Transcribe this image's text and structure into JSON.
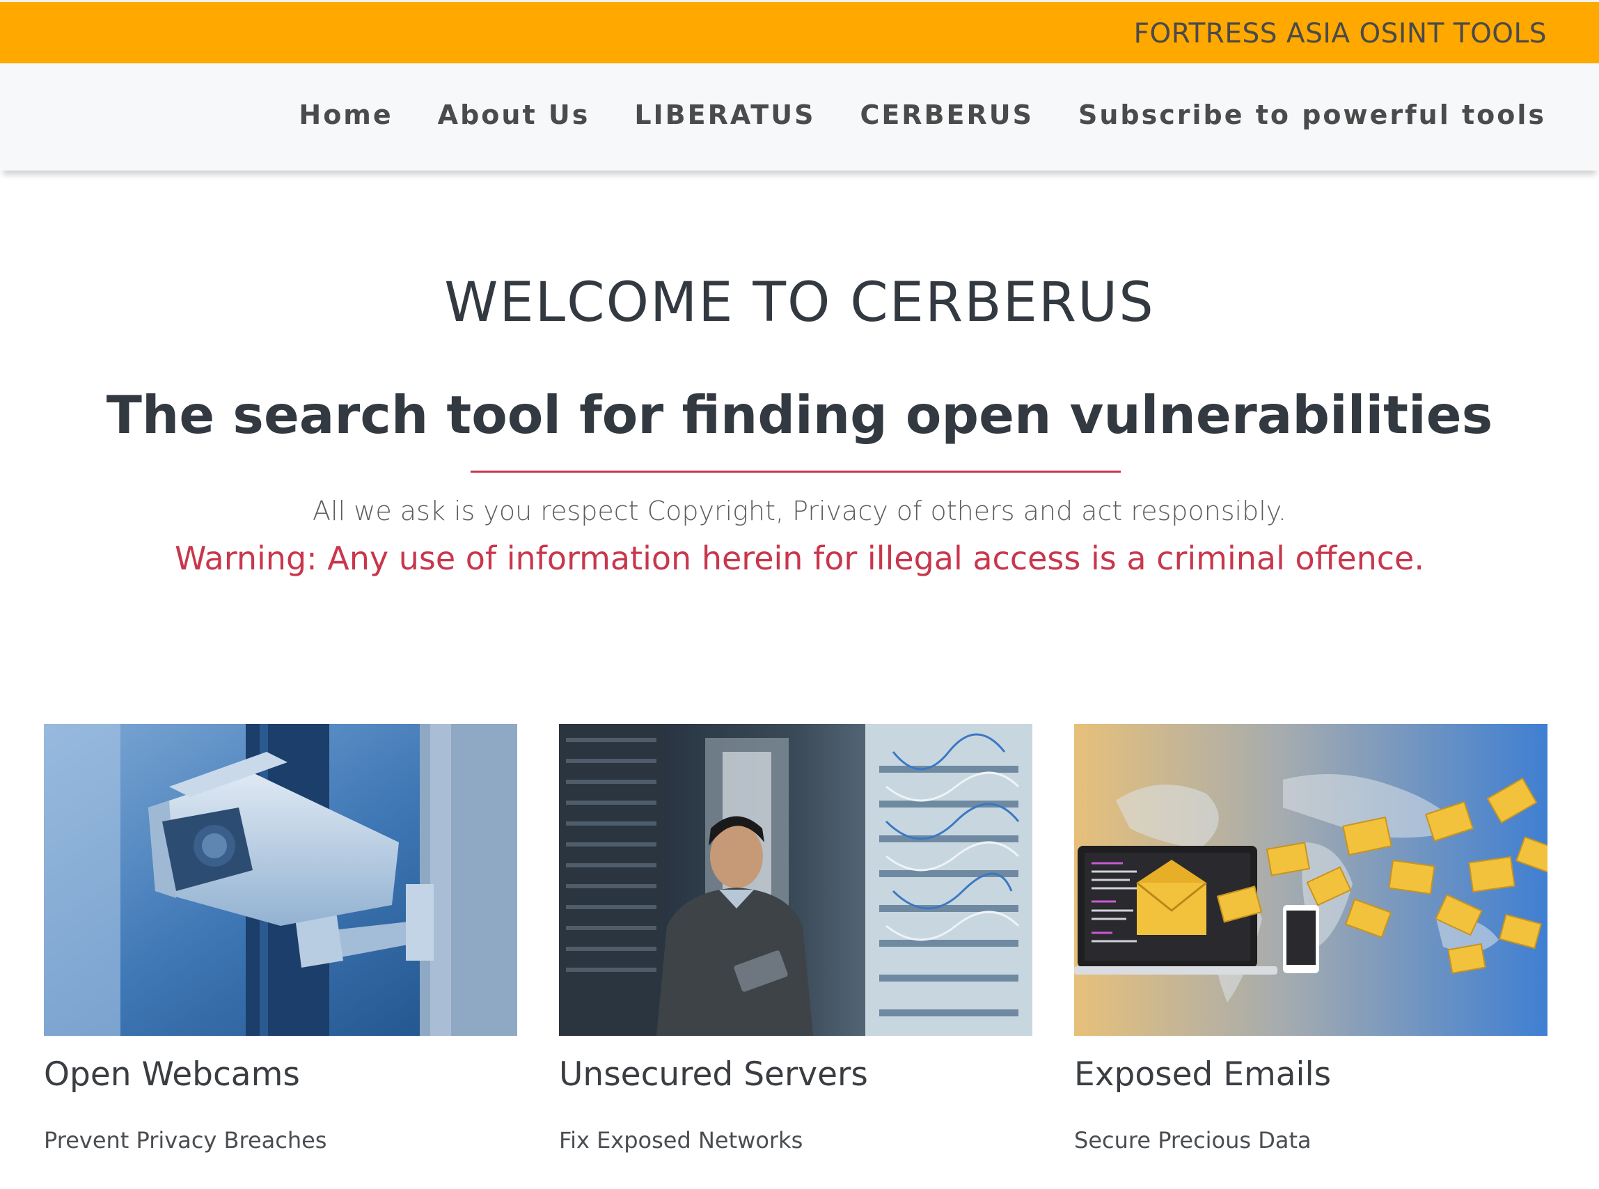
{
  "header": {
    "brand": "FORTRESS ASIA OSINT TOOLS",
    "accent_color": "#ffa800"
  },
  "nav": {
    "items": [
      {
        "label": "Home"
      },
      {
        "label": "About Us"
      },
      {
        "label": "LIBERATUS"
      },
      {
        "label": "CERBERUS"
      },
      {
        "label": "Subscribe to powerful tools"
      }
    ]
  },
  "hero": {
    "title": "WELCOME TO CERBERUS",
    "tagline": "The search tool for finding open vulnerabilities",
    "notice": "All we ask is you respect Copyright, Privacy of others and act responsibly.",
    "warning": "Warning: Any use of information herein for illegal access is a criminal offence.",
    "warning_color": "#c8374c"
  },
  "cards": [
    {
      "title": "Open Webcams",
      "subtitle": "Prevent Privacy Breaches",
      "image": "security-camera-photo"
    },
    {
      "title": "Unsecured Servers",
      "subtitle": "Fix Exposed Networks",
      "image": "server-room-photo"
    },
    {
      "title": "Exposed Emails",
      "subtitle": "Secure Precious Data",
      "image": "email-envelopes-illustration"
    }
  ]
}
